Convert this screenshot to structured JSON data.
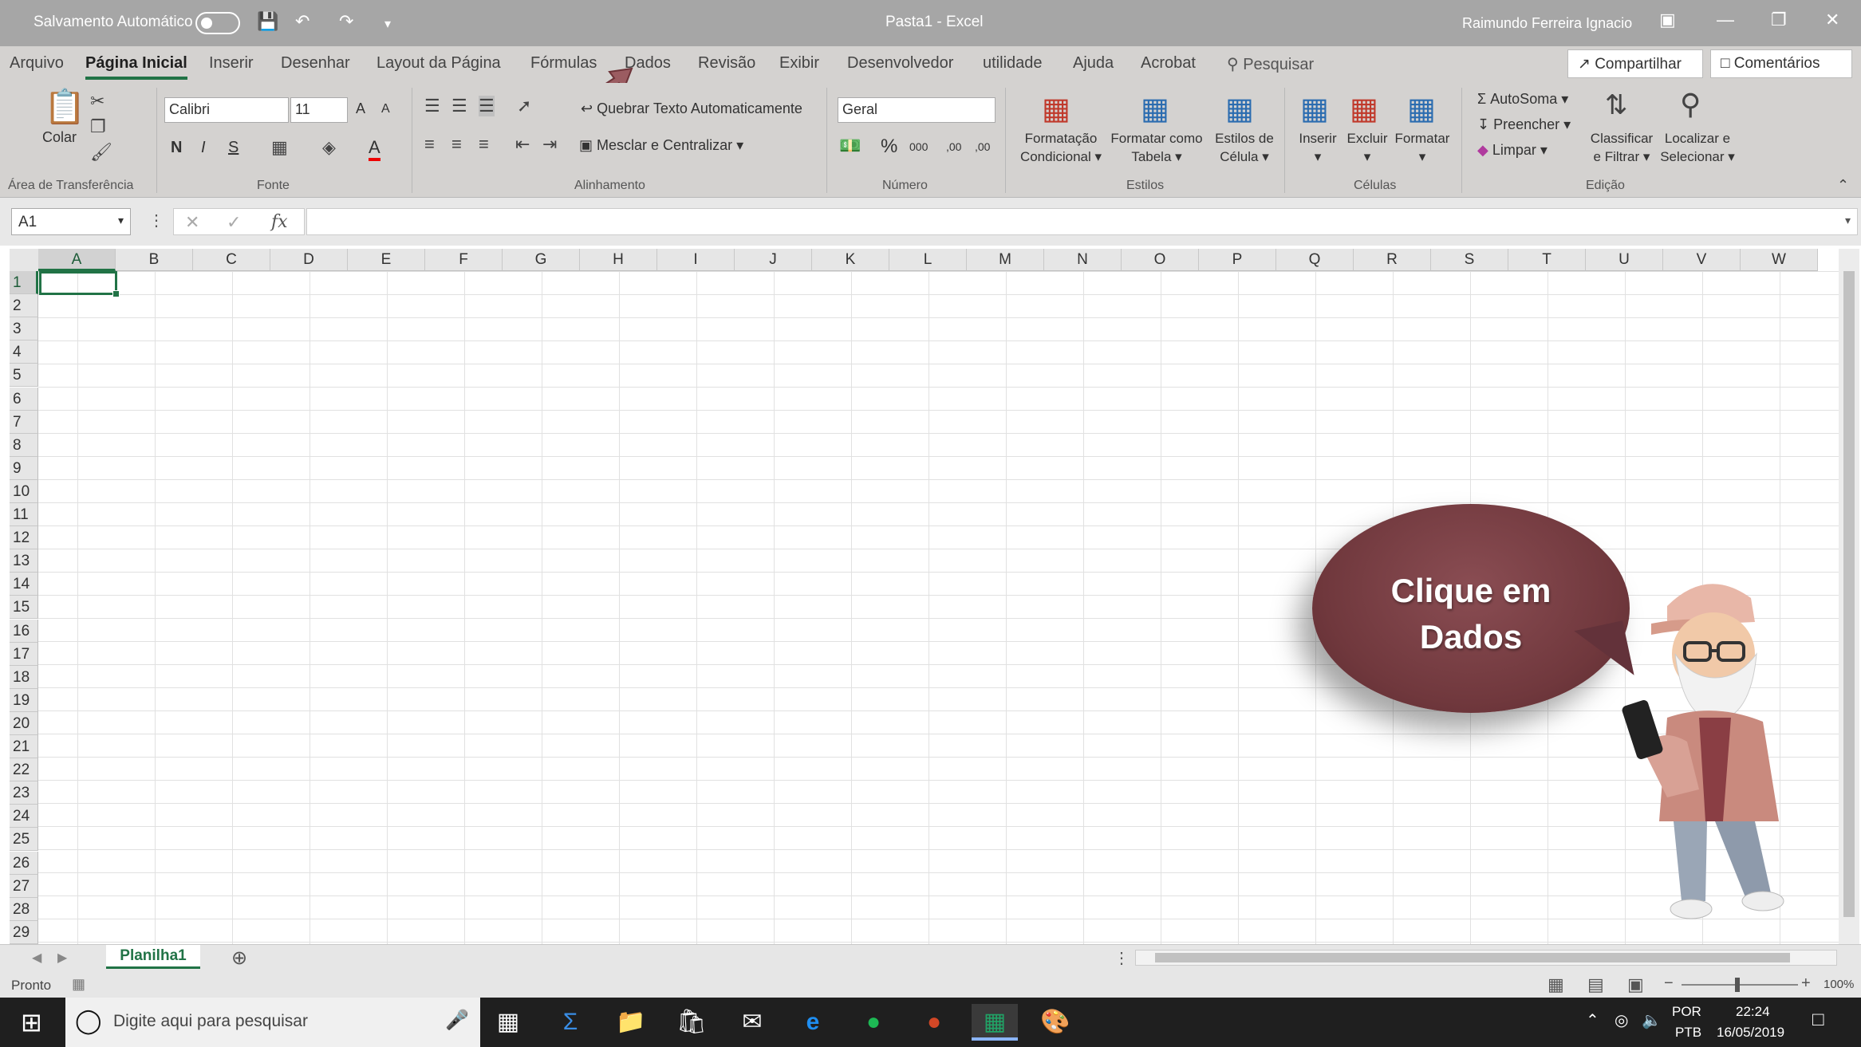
{
  "titlebar": {
    "autosave_label": "Salvamento Automático",
    "document_title": "Pasta1  -  Excel",
    "user_name": "Raimundo Ferreira Ignacio"
  },
  "tabs": [
    "Arquivo",
    "Página Inicial",
    "Inserir",
    "Desenhar",
    "Layout da Página",
    "Fórmulas",
    "Dados",
    "Revisão",
    "Exibir",
    "Desenvolvedor",
    "utilidade",
    "Ajuda",
    "Acrobat"
  ],
  "search_label": "Pesquisar",
  "share_label": "Compartilhar",
  "comments_label": "Comentários",
  "ribbon": {
    "clipboard": {
      "paste": "Colar",
      "group": "Área de Transferência"
    },
    "font": {
      "name": "Calibri",
      "size": "11",
      "bold": "N",
      "italic": "I",
      "underline": "S",
      "color_letter": "A",
      "grow": "A",
      "shrink": "A",
      "group": "Fonte"
    },
    "alignment": {
      "wrap": "Quebrar Texto Automaticamente",
      "merge": "Mesclar e Centralizar",
      "group": "Alinhamento"
    },
    "number": {
      "format": "Geral",
      "percent": "%",
      "thousands": "000",
      "inc_decimal": ",00",
      "dec_decimal": ",00",
      "group": "Número"
    },
    "styles": {
      "conditional_1": "Formatação",
      "conditional_2": "Condicional",
      "table_1": "Formatar como",
      "table_2": "Tabela",
      "cell_1": "Estilos de",
      "cell_2": "Célula",
      "group": "Estilos"
    },
    "cells": {
      "insert": "Inserir",
      "delete": "Excluir",
      "format": "Formatar",
      "group": "Células"
    },
    "editing": {
      "autosum": "AutoSoma",
      "fill": "Preencher",
      "clear": "Limpar",
      "sort_1": "Classificar",
      "sort_2": "e Filtrar",
      "find_1": "Localizar e",
      "find_2": "Selecionar",
      "group": "Edição"
    }
  },
  "formula_bar": {
    "name_box": "A1",
    "fx": "fx",
    "value": ""
  },
  "columns": [
    "A",
    "B",
    "C",
    "D",
    "E",
    "F",
    "G",
    "H",
    "I",
    "J",
    "K",
    "L",
    "M",
    "N",
    "O",
    "P",
    "Q",
    "R",
    "S",
    "T",
    "U",
    "V",
    "W"
  ],
  "rows": [
    "1",
    "2",
    "3",
    "4",
    "5",
    "6",
    "7",
    "8",
    "9",
    "10",
    "11",
    "12",
    "13",
    "14",
    "15",
    "16",
    "17",
    "18",
    "19",
    "20",
    "21",
    "22",
    "23",
    "24",
    "25",
    "26",
    "27",
    "28",
    "29"
  ],
  "sheet": {
    "tab": "Planilha1"
  },
  "status": {
    "ready": "Pronto",
    "zoom": "100%"
  },
  "taskbar": {
    "search_placeholder": "Digite aqui para pesquisar",
    "lang_1": "POR",
    "lang_2": "PTB",
    "time": "22:24",
    "date": "16/05/2019"
  },
  "callout": {
    "line1": "Clique em",
    "line2": "Dados"
  }
}
